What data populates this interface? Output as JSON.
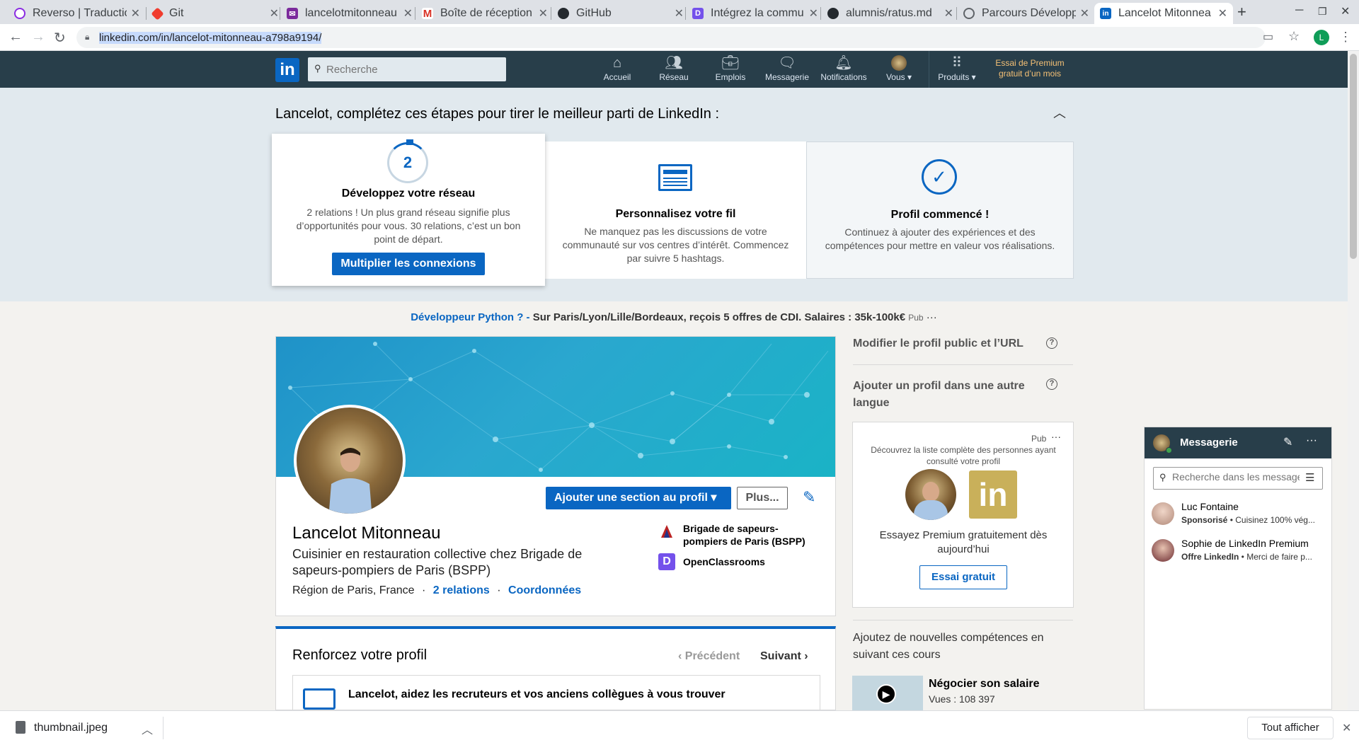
{
  "browser": {
    "tabs": [
      {
        "label": "Reverso | Traductio",
        "icon": "reverso-icon",
        "color": "#8a2be2"
      },
      {
        "label": "Git",
        "icon": "git-icon",
        "color": "#f03c2e"
      },
      {
        "label": "lancelotmitonneau",
        "icon": "mail-icon",
        "color": "#7b2a9c"
      },
      {
        "label": "Boîte de réception",
        "icon": "gmail-icon",
        "color": "#d93025"
      },
      {
        "label": "GitHub",
        "icon": "github-icon",
        "color": "#24292e"
      },
      {
        "label": "Intégrez la commu",
        "icon": "openclassrooms-icon",
        "color": "#7451eb"
      },
      {
        "label": "alumnis/ratus.md",
        "icon": "github-icon",
        "color": "#24292e"
      },
      {
        "label": "Parcours Développ",
        "icon": "globe-icon",
        "color": "#5f6368"
      },
      {
        "label": "Lancelot Mitonnea",
        "icon": "linkedin-icon",
        "color": "#0a66c2"
      }
    ],
    "new_tab": "+",
    "url_host": "linkedin.com",
    "url_path": "/in/lancelot-mitonneau-a798a9194/",
    "profile_initial": "L"
  },
  "linkedin_nav": {
    "logo": "in",
    "search_placeholder": "Recherche",
    "items": [
      "Accueil",
      "Réseau",
      "Emplois",
      "Messagerie",
      "Notifications",
      "Vous",
      "Produits"
    ],
    "premium": "Essai de Premium gratuit d’un mois"
  },
  "steps": {
    "heading": "Lancelot, complétez ces étapes pour tirer le meilleur parti de LinkedIn :",
    "cards": [
      {
        "number": "2",
        "title": "Développez votre réseau",
        "text": "2 relations ! Un plus grand réseau signifie plus d’opportunités pour vous. 30 relations, c’est un bon point de départ.",
        "button": "Multiplier les connexions"
      },
      {
        "title": "Personnalisez votre fil",
        "text": "Ne manquez pas les discussions de votre communauté sur vos centres d’intérêt. Commencez par suivre 5 hashtags."
      },
      {
        "title": "Profil commencé !",
        "text": "Continuez à ajouter des expériences et des compétences pour mettre en valeur vos réalisations."
      }
    ]
  },
  "ad": {
    "link": "Développeur Python ? -",
    "text": "Sur Paris/Lyon/Lille/Bordeaux, reçois 5 offres de CDI. Salaires : 35k-100k€",
    "pub": "Pub",
    "more": "···"
  },
  "profile": {
    "add_section": "Ajouter une section au profil",
    "more": "Plus...",
    "name": "Lancelot Mitonneau",
    "headline": "Cuisinier en restauration collective chez Brigade de sapeurs-pompiers de Paris (BSPP)",
    "location": "Région de Paris, France",
    "dot": "·",
    "relations": "2 relations",
    "contact": "Coordonnées",
    "companies": [
      "Brigade de sapeurs-pompiers de Paris (BSPP)",
      "OpenClassrooms"
    ]
  },
  "strengthen": {
    "title": "Renforcez votre profil",
    "prev": "Précédent",
    "next": "Suivant",
    "item": "Lancelot, aidez les recruteurs et vos anciens collègues à vous trouver"
  },
  "sidebar": {
    "edit_public": "Modifier le profil public et l’URL",
    "add_language": "Ajouter un profil dans une autre langue",
    "help": "?",
    "premium_ad": {
      "pub": "Pub",
      "more": "···",
      "text": "Découvrez la liste complète des personnes ayant consulté votre profil",
      "cta_text": "Essayez Premium gratuitement dès aujourd’hui",
      "button": "Essai gratuit",
      "logo": "in"
    },
    "courses_title": "Ajoutez de nouvelles compétences en suivant ces cours",
    "course": {
      "title": "Négocier son salaire",
      "views": "Vues : 108 397"
    }
  },
  "messaging": {
    "title": "Messagerie",
    "search_placeholder": "Recherche dans les messages",
    "conversations": [
      {
        "name": "Luc Fontaine",
        "tag": "Sponsorisé",
        "preview": "Cuisinez 100% vég..."
      },
      {
        "name": "Sophie de LinkedIn Premium",
        "tag": "Offre LinkedIn",
        "preview": "Merci de faire p..."
      }
    ]
  },
  "downloads": {
    "file": "thumbnail.jpeg",
    "show_all": "Tout afficher"
  }
}
